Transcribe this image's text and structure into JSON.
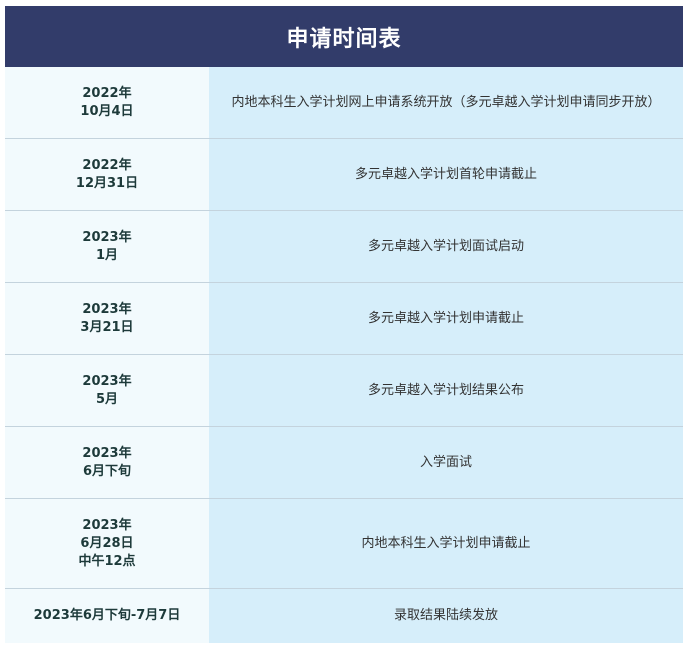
{
  "title": "申请时间表",
  "rows": [
    {
      "date_lines": [
        "2022年",
        "10月4日"
      ],
      "event": "内地本科生入学计划网上申请系统开放（多元卓越入学计划申请同步开放）"
    },
    {
      "date_lines": [
        "2022年",
        "12月31日"
      ],
      "event": "多元卓越入学计划首轮申请截止"
    },
    {
      "date_lines": [
        "2023年",
        "1月"
      ],
      "event": "多元卓越入学计划面试启动"
    },
    {
      "date_lines": [
        "2023年",
        "3月21日"
      ],
      "event": "多元卓越入学计划申请截止"
    },
    {
      "date_lines": [
        "2023年",
        "5月"
      ],
      "event": "多元卓越入学计划结果公布"
    },
    {
      "date_lines": [
        "2023年",
        "6月下旬"
      ],
      "event": "入学面试"
    },
    {
      "date_lines": [
        "2023年",
        "6月28日",
        "中午12点"
      ],
      "event": "内地本科生入学计划申请截止"
    },
    {
      "date_lines": [
        "2023年6月下旬-7月7日"
      ],
      "event": "录取结果陆续发放"
    }
  ],
  "colors": {
    "header_bg": "#323c6a",
    "date_bg": "#f2fafd",
    "event_bg": "#d6eefa"
  }
}
